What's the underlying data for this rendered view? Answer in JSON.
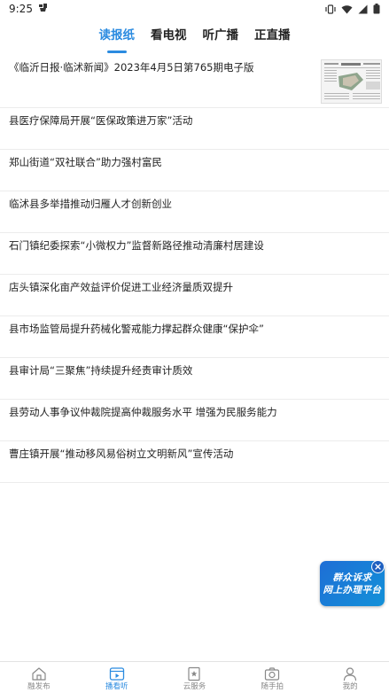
{
  "status_bar": {
    "time": "9:25",
    "left_icon": "notification-app-icon",
    "right_icons": [
      "vibrate-icon",
      "wifi-icon",
      "signal-icon",
      "battery-icon"
    ]
  },
  "tabs": [
    {
      "label": "读报纸",
      "active": true
    },
    {
      "label": "看电视",
      "active": false
    },
    {
      "label": "听广播",
      "active": false
    },
    {
      "label": "正直播",
      "active": false
    }
  ],
  "newspaper": {
    "title": "《临沂日报·临沭新闻》2023年4月5日第765期电子版"
  },
  "news": [
    "县医疗保障局开展“医保政策进万家”活动",
    "郑山街道“双社联合”助力强村富民",
    "临沭县多举措推动归雁人才创新创业",
    "石门镇纪委探索“小微权力”监督新路径推动清廉村居建设",
    "店头镇深化亩产效益评价促进工业经济量质双提升",
    "县市场监管局提升药械化警戒能力撑起群众健康“保护伞”",
    "县审计局“三聚焦”持续提升经责审计质效",
    "县劳动人事争议仲裁院提高仲裁服务水平  增强为民服务能力",
    "曹庄镇开展“推动移风易俗树立文明新风”宣传活动"
  ],
  "promo": {
    "line1": "群众诉求",
    "line2": "网上办理平台"
  },
  "bottom_nav": [
    {
      "label": "融发布",
      "icon": "home-icon",
      "active": false
    },
    {
      "label": "播看听",
      "icon": "play-icon",
      "active": true
    },
    {
      "label": "云服务",
      "icon": "service-icon",
      "active": false
    },
    {
      "label": "随手拍",
      "icon": "camera-icon",
      "active": false
    },
    {
      "label": "我的",
      "icon": "user-icon",
      "active": false
    }
  ],
  "colors": {
    "accent": "#2b8be0",
    "promo_bg": "#1e6ed6",
    "text": "#222222",
    "divider": "#ececec"
  }
}
